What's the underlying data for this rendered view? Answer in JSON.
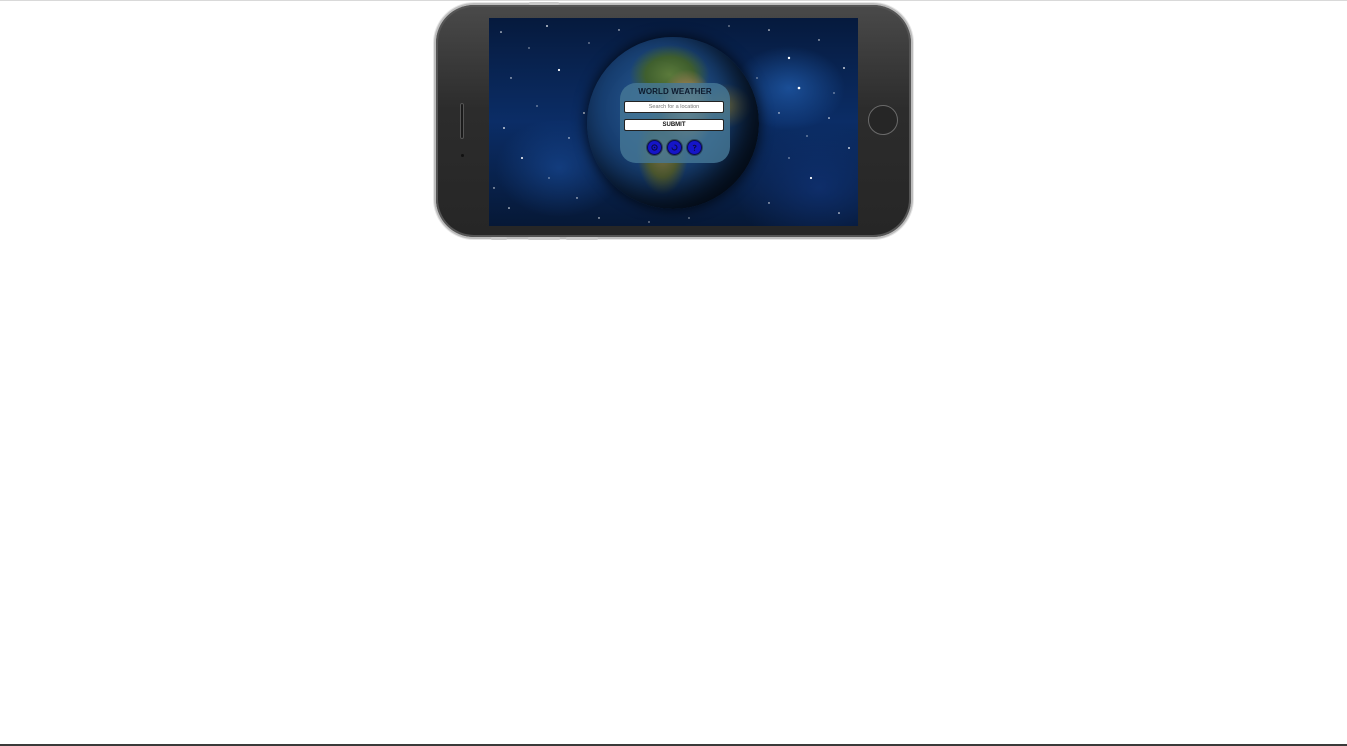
{
  "app": {
    "title": "WORLD WEATHER"
  },
  "search": {
    "placeholder": "Search for a location",
    "value": ""
  },
  "actions": {
    "submit_label": "SUBMIT"
  },
  "icons": [
    {
      "name": "location-icon"
    },
    {
      "name": "refresh-icon"
    },
    {
      "name": "info-icon"
    }
  ],
  "colors": {
    "panel": "#4678a0",
    "icon_button": "#1515c8",
    "space": "#0b2d66"
  }
}
